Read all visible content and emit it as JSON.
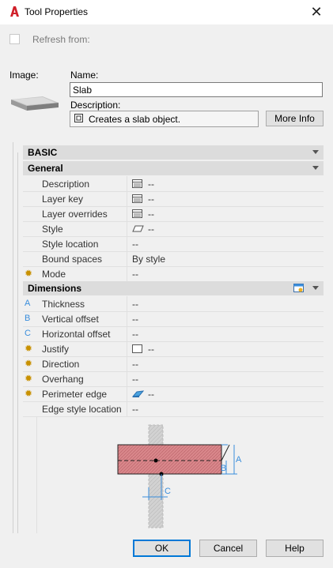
{
  "window": {
    "title": "Tool Properties",
    "close_glyph": "✕"
  },
  "refresh": {
    "label": "Refresh from:",
    "checked": false
  },
  "image": {
    "label": "Image:"
  },
  "name": {
    "label": "Name:",
    "value": "Slab"
  },
  "description": {
    "label": "Description:",
    "text": "Creates a slab object."
  },
  "buttons": {
    "more_info": "More Info",
    "ok": "OK",
    "cancel": "Cancel",
    "help": "Help"
  },
  "categories": {
    "basic": "BASIC",
    "general": "General",
    "dimensions": "Dimensions"
  },
  "general_rows": [
    {
      "name": "Description",
      "value": "--",
      "icon": "table-icon"
    },
    {
      "name": "Layer key",
      "value": "--",
      "icon": "table-icon"
    },
    {
      "name": "Layer overrides",
      "value": "--",
      "icon": "table-icon"
    },
    {
      "name": "Style",
      "value": "--",
      "icon": "style-icon"
    },
    {
      "name": "Style location",
      "value": "--"
    },
    {
      "name": "Bound spaces",
      "value": "By style"
    },
    {
      "name": "Mode",
      "value": "--",
      "marker": "star"
    }
  ],
  "dimension_rows": [
    {
      "name": "Thickness",
      "value": "--",
      "marker": "A"
    },
    {
      "name": "Vertical offset",
      "value": "--",
      "marker": "B"
    },
    {
      "name": "Horizontal offset",
      "value": "--",
      "marker": "C"
    },
    {
      "name": "Justify",
      "value": "--",
      "marker": "star",
      "icon": "justify-icon"
    },
    {
      "name": "Direction",
      "value": "--",
      "marker": "star"
    },
    {
      "name": "Overhang",
      "value": "--",
      "marker": "star"
    },
    {
      "name": "Perimeter edge",
      "value": "--",
      "marker": "star",
      "icon": "edge-icon"
    },
    {
      "name": "Edge style location",
      "value": "--"
    }
  ],
  "diagram_labels": {
    "a": "A",
    "b": "B",
    "c": "C"
  },
  "colors": {
    "slab_fill": "#d9878b",
    "accent": "#3a8edc",
    "star": "#c89000"
  }
}
